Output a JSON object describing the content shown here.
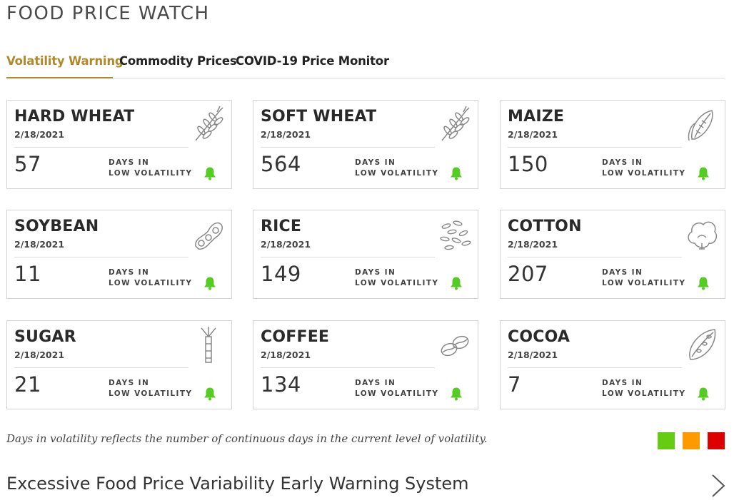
{
  "page": {
    "title": "FOOD PRICE WATCH"
  },
  "tabs": [
    {
      "label": "Volatility Warning",
      "active": true
    },
    {
      "label": "Commodity Prices",
      "active": false
    },
    {
      "label": "COVID-19 Price Monitor",
      "active": false
    }
  ],
  "cards": [
    {
      "name": "HARD WHEAT",
      "date": "2/18/2021",
      "days": "57",
      "caption_line1": "DAYS IN",
      "caption_line2": "LOW VOLATILITY",
      "icon": "wheat-icon",
      "status_color": "#55cc22"
    },
    {
      "name": "SOFT WHEAT",
      "date": "2/18/2021",
      "days": "564",
      "caption_line1": "DAYS IN",
      "caption_line2": "LOW VOLATILITY",
      "icon": "wheat-icon",
      "status_color": "#55cc22"
    },
    {
      "name": "MAIZE",
      "date": "2/18/2021",
      "days": "150",
      "caption_line1": "DAYS IN",
      "caption_line2": "LOW VOLATILITY",
      "icon": "corn-icon",
      "status_color": "#55cc22"
    },
    {
      "name": "SOYBEAN",
      "date": "2/18/2021",
      "days": "11",
      "caption_line1": "DAYS IN",
      "caption_line2": "LOW VOLATILITY",
      "icon": "soybean-icon",
      "status_color": "#55cc22"
    },
    {
      "name": "RICE",
      "date": "2/18/2021",
      "days": "149",
      "caption_line1": "DAYS IN",
      "caption_line2": "LOW VOLATILITY",
      "icon": "rice-icon",
      "status_color": "#55cc22"
    },
    {
      "name": "COTTON",
      "date": "2/18/2021",
      "days": "207",
      "caption_line1": "DAYS IN",
      "caption_line2": "LOW VOLATILITY",
      "icon": "cotton-icon",
      "status_color": "#55cc22"
    },
    {
      "name": "SUGAR",
      "date": "2/18/2021",
      "days": "21",
      "caption_line1": "DAYS IN",
      "caption_line2": "LOW VOLATILITY",
      "icon": "sugarcane-icon",
      "status_color": "#55cc22"
    },
    {
      "name": "COFFEE",
      "date": "2/18/2021",
      "days": "134",
      "caption_line1": "DAYS IN",
      "caption_line2": "LOW VOLATILITY",
      "icon": "coffee-bean-icon",
      "status_color": "#55cc22"
    },
    {
      "name": "COCOA",
      "date": "2/18/2021",
      "days": "7",
      "caption_line1": "DAYS IN",
      "caption_line2": "LOW VOLATILITY",
      "icon": "cocoa-pod-icon",
      "status_color": "#55cc22"
    }
  ],
  "footnote": "Days in volatility reflects the number of continuous days in the current level of volatility.",
  "legend": {
    "colors": [
      "#66cc11",
      "#ff9900",
      "#dd0000"
    ]
  },
  "ews_link": {
    "label": "Excessive Food Price Variability Early Warning System"
  },
  "colors": {
    "accent": "#b0892a",
    "low_volatility": "#55cc22"
  }
}
